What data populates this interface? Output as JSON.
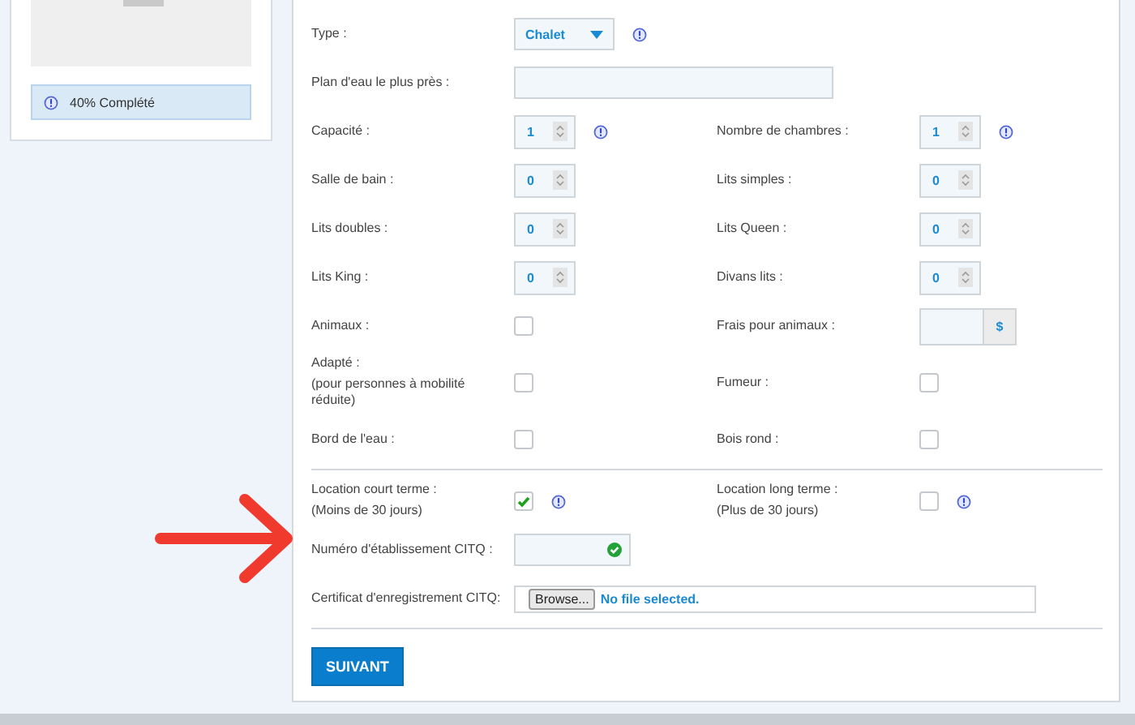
{
  "sidebar": {
    "progress": {
      "text": "40% Complété"
    }
  },
  "form": {
    "sections": [
      {
        "rows": [
          [
            {
              "label": "Type :",
              "kind": "select",
              "value": "Chalet",
              "info": true
            }
          ],
          [
            {
              "label": "Plan d'eau le plus près :",
              "kind": "text"
            }
          ],
          [
            {
              "label": "Capacité :",
              "kind": "number",
              "value": "1",
              "info": true
            },
            {
              "label": "Nombre de chambres :",
              "kind": "number",
              "value": "1",
              "info": true
            }
          ],
          [
            {
              "label": "Salle de bain :",
              "kind": "number",
              "value": "0"
            },
            {
              "label": "Lits simples :",
              "kind": "number",
              "value": "0"
            }
          ],
          [
            {
              "label": "Lits doubles :",
              "kind": "number",
              "value": "0"
            },
            {
              "label": "Lits Queen :",
              "kind": "number",
              "value": "0"
            }
          ],
          [
            {
              "label": "Lits King :",
              "kind": "number",
              "value": "0"
            },
            {
              "label": "Divans lits :",
              "kind": "number",
              "value": "0"
            }
          ],
          [
            {
              "label": "Animaux :",
              "kind": "checkbox",
              "checked": false
            },
            {
              "label": "Frais pour animaux :",
              "kind": "money",
              "unit": "$"
            }
          ],
          [
            {
              "label": "Adapté :",
              "note": "(pour personnes à mobilité réduite)",
              "kind": "checkbox",
              "checked": false
            },
            {
              "label": "Fumeur :",
              "kind": "checkbox",
              "checked": false
            }
          ],
          [
            {
              "label": "Bord de l'eau :",
              "kind": "checkbox",
              "checked": false
            },
            {
              "label": "Bois rond :",
              "kind": "checkbox",
              "checked": false
            }
          ]
        ]
      },
      {
        "rows": [
          [
            {
              "label": "Location court terme :",
              "note": "(Moins de 30 jours)",
              "kind": "checkbox",
              "checked": true,
              "info": true
            },
            {
              "label": "Location long terme :",
              "note": "(Plus de 30 jours)",
              "kind": "checkbox",
              "checked": false,
              "info": true
            }
          ],
          [
            {
              "label": "Numéro d'établissement CITQ :",
              "kind": "validated",
              "valid": true
            }
          ],
          [
            {
              "label": "Certificat d'enregistrement CITQ:",
              "kind": "file",
              "button": "Browse...",
              "status": "No file selected."
            }
          ]
        ]
      }
    ],
    "submit": "SUIVANT"
  }
}
